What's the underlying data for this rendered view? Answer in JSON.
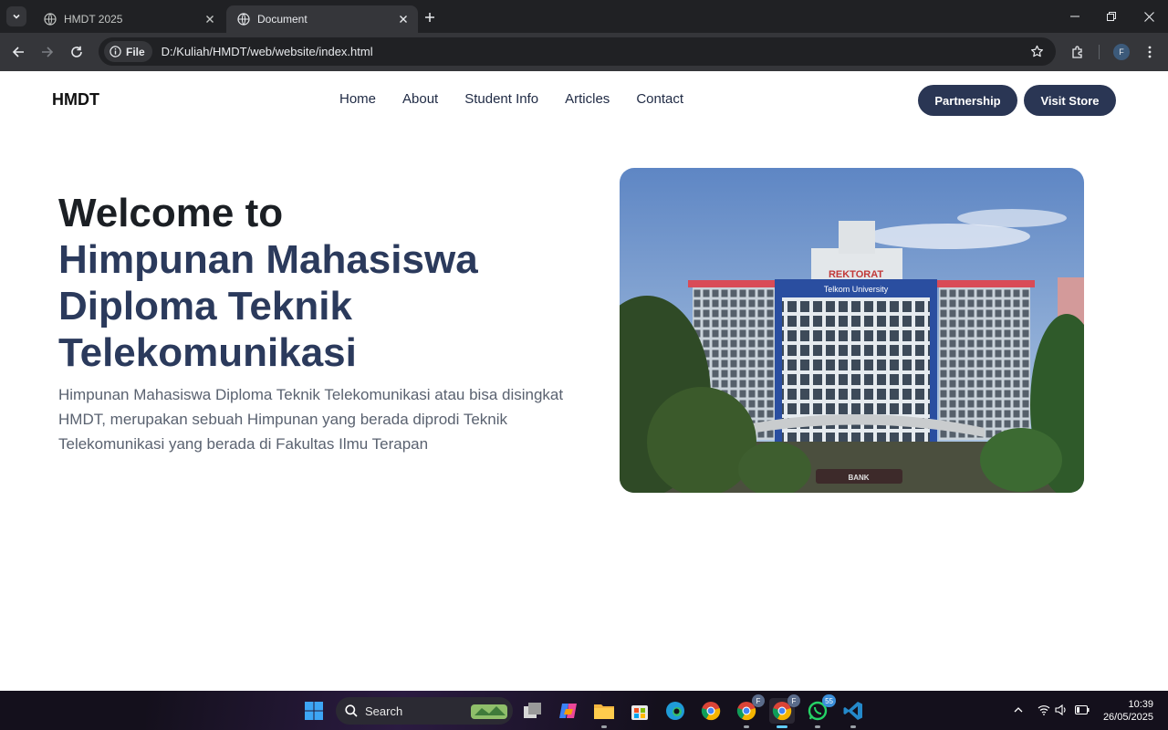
{
  "browser": {
    "tabs": [
      {
        "title": "HMDT 2025",
        "active": false
      },
      {
        "title": "Document",
        "active": true
      }
    ],
    "omnibox": {
      "chip_label": "File",
      "url": "D:/Kuliah/HMDT/web/website/index.html"
    },
    "profile_initial": "F"
  },
  "site": {
    "brand": "HMDT",
    "nav": [
      "Home",
      "About",
      "Student Info",
      "Articles",
      "Contact"
    ],
    "cta": {
      "partnership": "Partnership",
      "visit_store": "Visit Store"
    },
    "hero": {
      "title_line1": "Welcome to",
      "title_accent": "Himpunan Mahasiswa Diploma Teknik Telekomunikasi",
      "description": "Himpunan Mahasiswa Diploma Teknik Telekomunikasi atau bisa disingkat HMDT, merupakan sebuah Himpunan yang berada diprodi Teknik Telekomunikasi yang berada di Fakultas Ilmu Terapan",
      "image_signs": {
        "top": "REKTORAT",
        "band": "Telkom University",
        "base": "BANK"
      }
    }
  },
  "taskbar": {
    "search_label": "Search",
    "badges": {
      "chrome_profile": "F",
      "whatsapp": "55"
    },
    "time": "10:39",
    "date": "26/05/2025"
  },
  "colors": {
    "accent_navy": "#2a3654",
    "heading_accent": "#2b3a5c"
  }
}
